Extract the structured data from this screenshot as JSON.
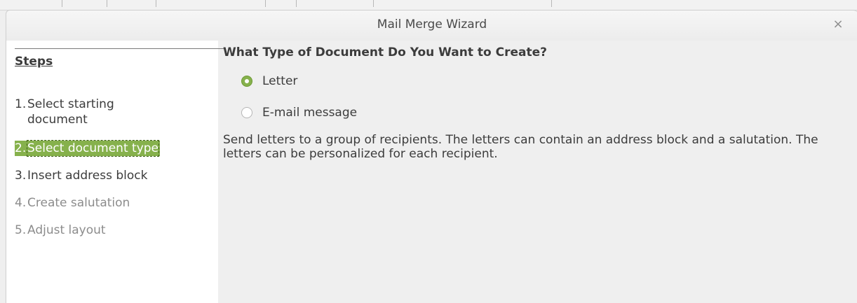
{
  "window": {
    "title": "Mail Merge Wizard",
    "close_glyph": "×"
  },
  "sidebar": {
    "heading": "Steps",
    "steps": [
      {
        "num": "1.",
        "label": "Select starting document",
        "state": "normal"
      },
      {
        "num": "2.",
        "label": "Select document type",
        "state": "active"
      },
      {
        "num": "3.",
        "label": "Insert address block",
        "state": "normal"
      },
      {
        "num": "4.",
        "label": "Create salutation",
        "state": "disabled"
      },
      {
        "num": "5.",
        "label": "Adjust layout",
        "state": "disabled"
      }
    ]
  },
  "main": {
    "question": "What Type of Document Do You Want to Create?",
    "options": [
      {
        "label": "Letter",
        "selected": true
      },
      {
        "label": "E-mail message",
        "selected": false
      }
    ],
    "description": "Send letters to a group of recipients. The letters can contain an address block and a salutation. The letters can be personalized for each recipient."
  },
  "colors": {
    "accent": "#86b14c",
    "background": "#efefef",
    "sidebar_bg": "#ffffff",
    "disabled_text": "#8c8c8c"
  }
}
